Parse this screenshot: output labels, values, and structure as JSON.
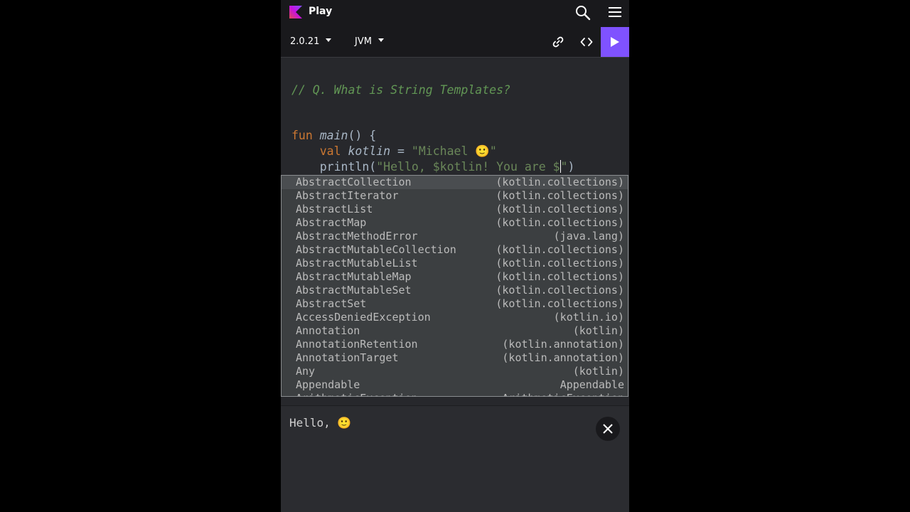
{
  "header": {
    "brand": "Play",
    "logo_icon": "kotlin-logo",
    "actions": [
      "search-icon",
      "hamburger-menu-icon"
    ]
  },
  "toolbar": {
    "version": "2.0.21",
    "target": "JVM",
    "icons": [
      "link-icon",
      "code-icon",
      "play-icon"
    ],
    "accent_color": "#7f52ff"
  },
  "editor": {
    "comment": "// Q. What is String Templates?",
    "line_fun_kw": "fun",
    "line_fun_name": "main",
    "line_fun_rest": "() {",
    "line_val_kw": "val",
    "line_val_name": "kotlin",
    "line_val_eq": " = ",
    "line_val_str": "\"Michael 🙂\"",
    "line_print_prefix": "println(",
    "line_print_str": "\"Hello, $kotlin! You are $",
    "line_print_str_end": "\"",
    "line_print_suffix": ")"
  },
  "completion": {
    "items": [
      {
        "name": "AbstractCollection",
        "pkg": "(kotlin.collections)"
      },
      {
        "name": "AbstractIterator",
        "pkg": "(kotlin.collections)"
      },
      {
        "name": "AbstractList",
        "pkg": "(kotlin.collections)"
      },
      {
        "name": "AbstractMap",
        "pkg": "(kotlin.collections)"
      },
      {
        "name": "AbstractMethodError",
        "pkg": "(java.lang)"
      },
      {
        "name": "AbstractMutableCollection",
        "pkg": "(kotlin.collections)"
      },
      {
        "name": "AbstractMutableList",
        "pkg": "(kotlin.collections)"
      },
      {
        "name": "AbstractMutableMap",
        "pkg": "(kotlin.collections)"
      },
      {
        "name": "AbstractMutableSet",
        "pkg": "(kotlin.collections)"
      },
      {
        "name": "AbstractSet",
        "pkg": "(kotlin.collections)"
      },
      {
        "name": "AccessDeniedException",
        "pkg": "(kotlin.io)"
      },
      {
        "name": "Annotation",
        "pkg": "(kotlin)"
      },
      {
        "name": "AnnotationRetention",
        "pkg": "(kotlin.annotation)"
      },
      {
        "name": "AnnotationTarget",
        "pkg": "(kotlin.annotation)"
      },
      {
        "name": "Any",
        "pkg": "(kotlin)"
      },
      {
        "name": "Appendable",
        "pkg": "Appendable"
      },
      {
        "name": "ArithmeticException",
        "pkg": "ArithmeticException"
      }
    ]
  },
  "output": {
    "text": "Hello, 🙂",
    "close_icon": "close-icon"
  }
}
